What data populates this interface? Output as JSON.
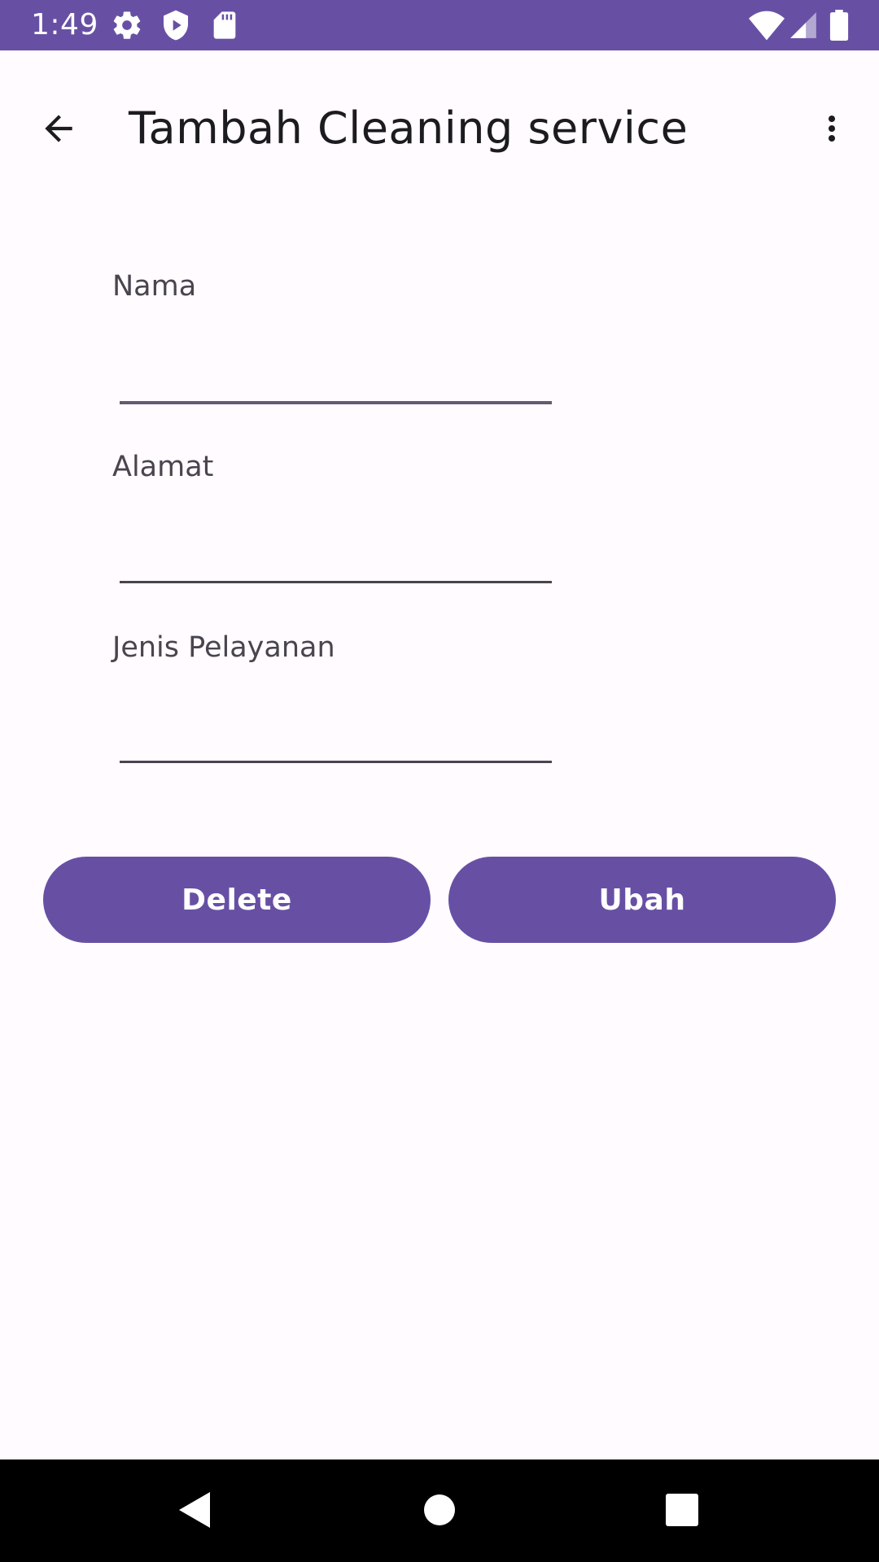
{
  "status_bar": {
    "time": "1:49",
    "icons": [
      "gear-icon",
      "shield-play-icon",
      "sd-card-icon",
      "wifi-icon",
      "signal-icon",
      "battery-icon"
    ]
  },
  "app_bar": {
    "title": "Tambah Cleaning service",
    "back_icon": "arrow-back-icon",
    "more_icon": "more-vert-icon"
  },
  "form": {
    "fields": [
      {
        "label": "Nama",
        "value": ""
      },
      {
        "label": "Alamat",
        "value": ""
      },
      {
        "label": "Jenis Pelayanan",
        "value": ""
      }
    ]
  },
  "buttons": {
    "delete_label": "Delete",
    "update_label": "Ubah"
  },
  "nav_bar": {
    "icons": [
      "back-triangle-icon",
      "home-circle-icon",
      "recents-square-icon"
    ]
  },
  "colors": {
    "primary": "#6750A4",
    "background": "#FFFBFE",
    "on_surface": "#1C1B1F",
    "on_surface_variant": "#49454F"
  }
}
